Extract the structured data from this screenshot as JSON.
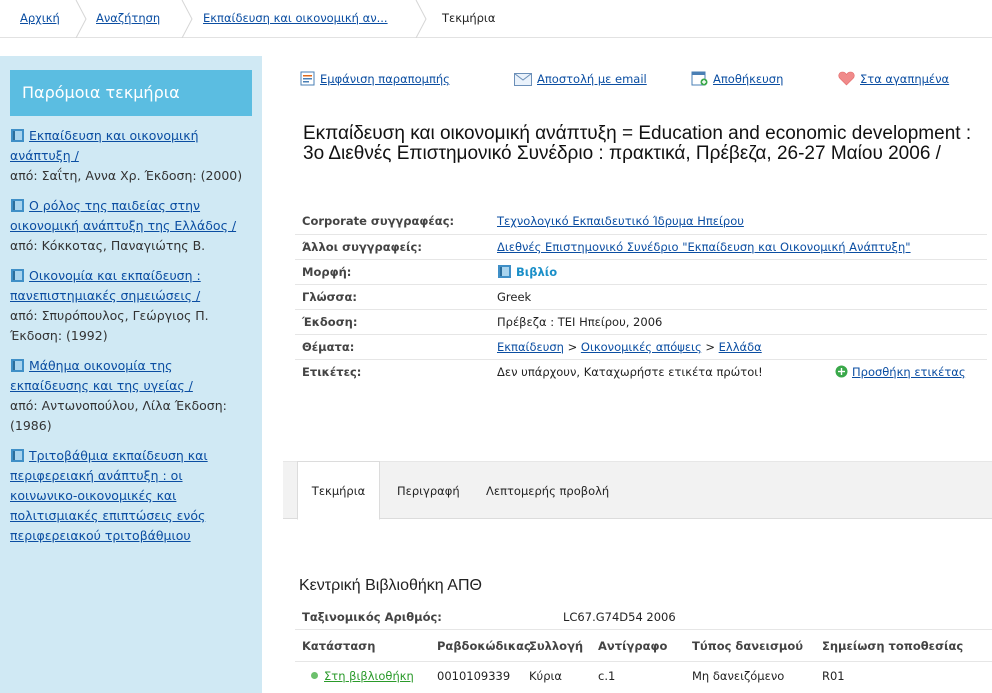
{
  "breadcrumb": {
    "items": [
      "Αρχική",
      "Αναζήτηση",
      "Εκπαίδευση και οικονομική αν...",
      "Τεκμήρια"
    ]
  },
  "sidebar": {
    "title": "Παρόμοια τεκμήρια",
    "items": [
      {
        "title": "Εκπαίδευση και οικονομική ανάπτυξη /",
        "author": "από: Σαΐτη, Αννα Χρ.",
        "edition": "Έκδοση: (2000)"
      },
      {
        "title": "Ο ρόλος της παιδείας στην οικονομική ανάπτυξη της Ελλάδος /",
        "author": "από: Κόκκοτας, Παναγιώτης Β.",
        "edition": ""
      },
      {
        "title": "Οικονομία και εκπαίδευση : πανεπιστημιακές σημειώσεις /",
        "author": "από: Σπυρόπουλος, Γεώργιος Π.",
        "edition": "Έκδοση: (1992)"
      },
      {
        "title": "Μάθημα οικονομία της εκπαίδευσης και της υγείας /",
        "author": "από: Αντωνοπούλου, Λίλα",
        "edition": "Έκδοση: (1986)"
      },
      {
        "title": "Τριτοβάθμια εκπαίδευση και περιφερειακή ανάπτυξη : οι κοινωνικο-οικονομικές και πολιτισμιακές επιπτώσεις ενός περιφερειακού τριτοβάθμιου",
        "author": "",
        "edition": ""
      }
    ]
  },
  "actions": {
    "cite": "Εμφάνιση παραπομπής",
    "email": "Αποστολή με email",
    "save": "Αποθήκευση",
    "favorite": "Στα αγαπημένα"
  },
  "record": {
    "title": "Εκπαίδευση και οικονομική ανάπτυξη = Education and economic development : 3ο Διεθνές Επιστημονικό Συνέδριο : πρακτικά, Πρέβεζα, 26-27 Μαίου 2006 /"
  },
  "details": {
    "corporate_label": "Corporate συγγραφέας:",
    "corporate_value": "Τεχνολογικό Εκπαιδευτικό Ίδρυμα Ηπείρου",
    "other_label": "Άλλοι συγγραφείς:",
    "other_value": "Διεθνές Επιστημονικό Συνέδριο \"Εκπαίδευση και Οικονομική Ανάπτυξη\"",
    "format_label": "Μορφή:",
    "format_value": "Βιβλίο",
    "language_label": "Γλώσσα:",
    "language_value": "Greek",
    "publication_label": "Έκδοση:",
    "publication_value": "Πρέβεζα : ΤΕΙ Ηπείρου, 2006",
    "subjects_label": "Θέματα:",
    "subject_1": "Εκπαίδευση",
    "subject_sep": ">",
    "subject_2": "Οικονομικές απόψεις",
    "subject_3": "Ελλάδα",
    "tags_label": "Ετικέτες:",
    "tags_value": "Δεν υπάρχουν, Καταχωρήστε ετικέτα πρώτοι!",
    "add_tag": "Προσθήκη ετικέτας"
  },
  "tabs": [
    "Τεκμήρια",
    "Περιγραφή",
    "Λεπτομερής προβολή"
  ],
  "holdings": {
    "library": "Κεντρική Βιβλιοθήκη ΑΠΘ",
    "callno_label": "Ταξινομικός Αριθμός:",
    "callno_value": "LC67.G74D54 2006",
    "headers": [
      "Κατάσταση",
      "Ραβδοκώδικας",
      "Συλλογή",
      "Αντίγραφο",
      "Τύπος δανεισμού",
      "Σημείωση τοποθεσίας"
    ],
    "row": {
      "status": "Στη βιβλιοθήκη",
      "barcode": "0010109339",
      "collection": "Κύρια",
      "copy": "c.1",
      "loan_type": "Μη δανειζόμενο",
      "location": "R01"
    }
  },
  "colors": {
    "sidebar_bg": "#d0e9f4",
    "sidebar_header": "#5bbde1",
    "link": "#0b4ea2",
    "available": "#2a9a2a"
  }
}
